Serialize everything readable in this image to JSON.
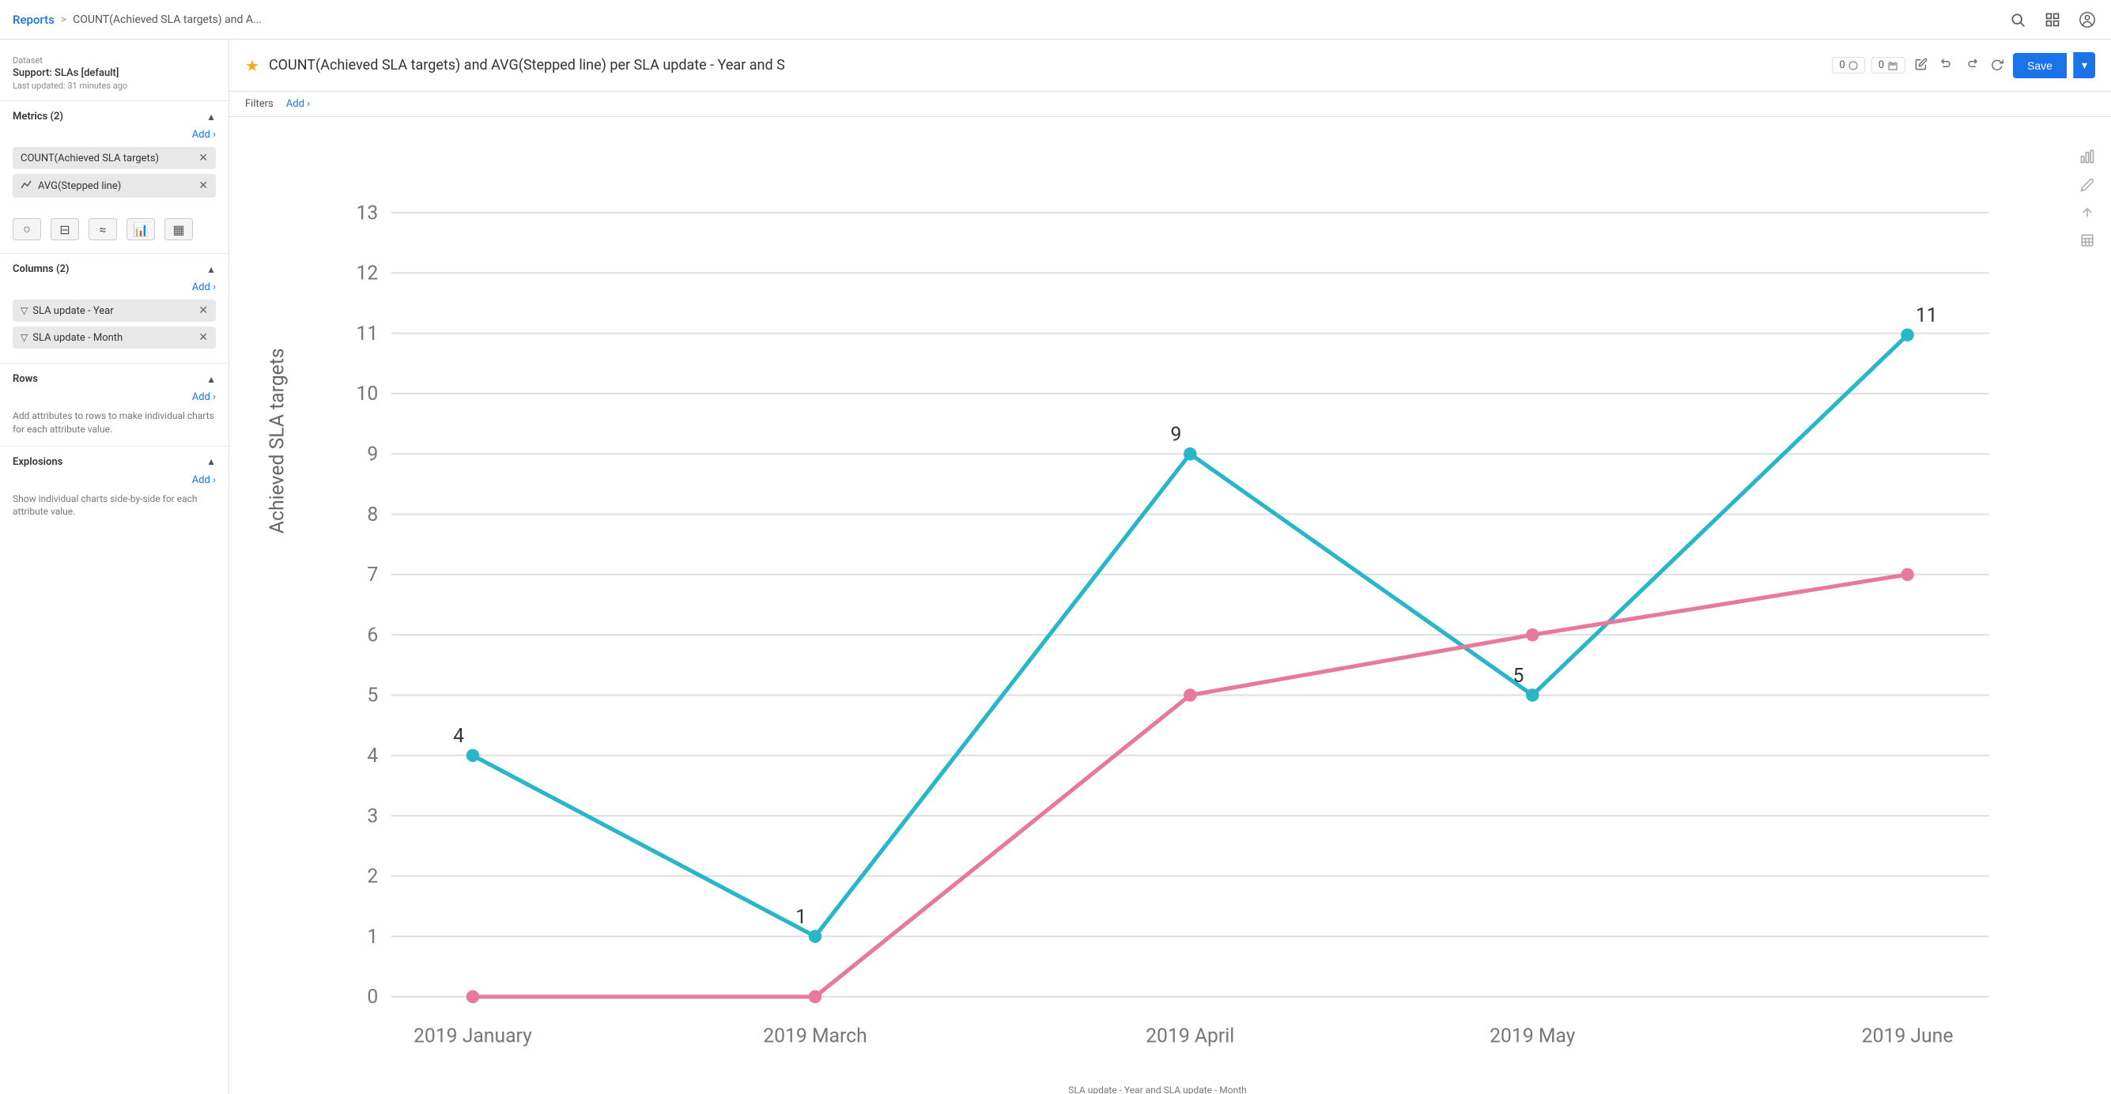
{
  "header": {
    "breadcrumb_reports": "Reports",
    "breadcrumb_sep": ">",
    "breadcrumb_title": "COUNT(Achieved SLA targets) and A...",
    "search_icon": "🔍",
    "grid_icon": "⊞",
    "user_icon": "👤"
  },
  "sidebar": {
    "dataset_label": "Dataset",
    "dataset_name": "Support: SLAs [default]",
    "dataset_updated": "Last updated: 31 minutes ago",
    "metrics_section": {
      "title": "Metrics (2)",
      "add_label": "Add ›",
      "metrics": [
        {
          "label": "COUNT(Achieved SLA targets)",
          "has_icon": false
        },
        {
          "label": "AVG(Stepped line)",
          "has_icon": true
        }
      ]
    },
    "columns_section": {
      "title": "Columns (2)",
      "add_label": "Add ›",
      "columns": [
        {
          "label": "SLA update - Year"
        },
        {
          "label": "SLA update - Month"
        }
      ]
    },
    "rows_section": {
      "title": "Rows",
      "add_label": "Add ›",
      "empty_text": "Add attributes to rows to make individual charts for each attribute value."
    },
    "explosions_section": {
      "title": "Explosions",
      "add_label": "Add ›",
      "empty_text": "Show individual charts side-by-side for each attribute value."
    }
  },
  "report": {
    "title": "COUNT(Achieved SLA targets) and AVG(Stepped line) per SLA update - Year and S",
    "star_filled": true,
    "counter1": "0",
    "counter2": "0",
    "save_label": "Save",
    "filters_label": "Filters",
    "filters_add": "Add ›"
  },
  "chart": {
    "y_axis_label": "Achieved SLA targets",
    "x_axis_label": "SLA update - Year and SLA update - Month",
    "y_max": 13,
    "y_ticks": [
      0,
      1,
      2,
      3,
      4,
      5,
      6,
      7,
      8,
      9,
      10,
      11,
      12,
      13
    ],
    "x_labels": [
      "2019 January",
      "2019 March",
      "2019 April",
      "2019 May",
      "2019 June"
    ],
    "line1": {
      "color": "#29b6c8",
      "points": [
        {
          "x": 0,
          "y": 4,
          "label": "4"
        },
        {
          "x": 1,
          "y": 1,
          "label": "1"
        },
        {
          "x": 2,
          "y": 9,
          "label": "9"
        },
        {
          "x": 3,
          "y": 5,
          "label": "5"
        },
        {
          "x": 4,
          "y": 11,
          "label": "11"
        }
      ]
    },
    "line2": {
      "color": "#e8799e",
      "points": [
        {
          "x": 0,
          "y": 0,
          "label": ""
        },
        {
          "x": 1,
          "y": 0,
          "label": ""
        },
        {
          "x": 2,
          "y": 5,
          "label": ""
        },
        {
          "x": 3,
          "y": 6,
          "label": ""
        },
        {
          "x": 4,
          "y": 7,
          "label": ""
        }
      ]
    }
  },
  "right_tools": [
    "bar-chart-icon",
    "pencil-icon",
    "sort-icon",
    "grid-icon"
  ]
}
